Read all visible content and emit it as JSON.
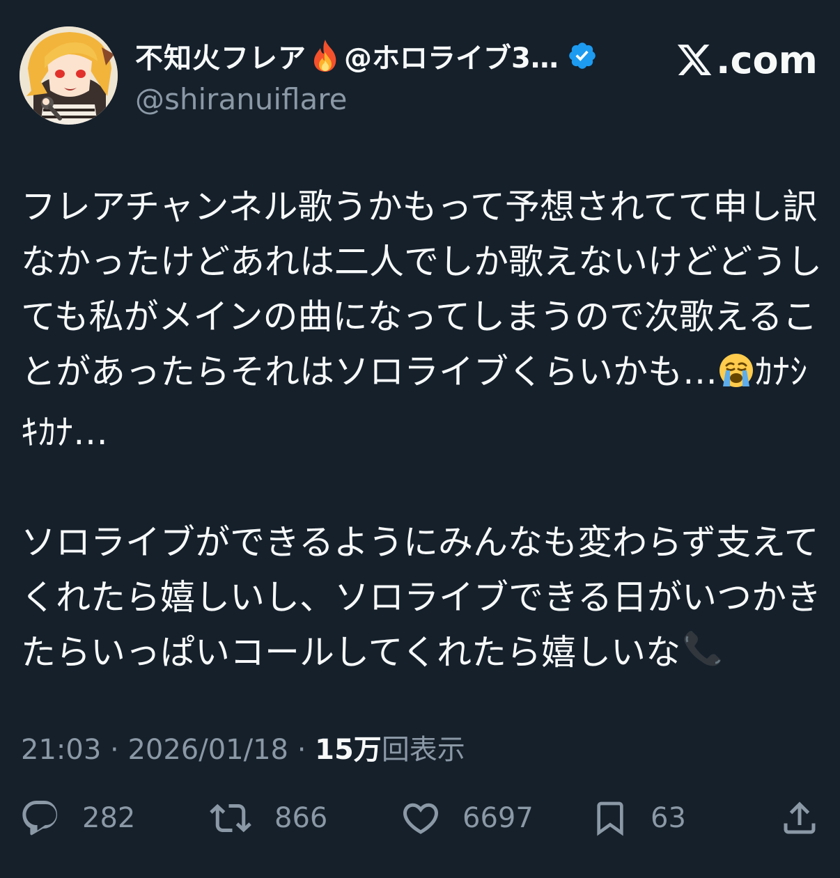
{
  "header": {
    "display_name": "不知火フレア",
    "org_name": "@ホロライブ3…",
    "handle": "@shiranuiflare",
    "brand": ".com"
  },
  "icons": {
    "avatar": "avatar-image",
    "name_emoji": "fire-icon",
    "badge": "verified-badge-icon",
    "logo": "x-logo-icon",
    "reply": "reply-icon",
    "retweet": "retweet-icon",
    "like": "heart-icon",
    "bookmark": "bookmark-icon",
    "share": "share-icon"
  },
  "colors": {
    "background": "#15202b",
    "text": "#f7f9f9",
    "muted": "#8b98a5",
    "verified": "#1d9bf0"
  },
  "tweet": {
    "paragraph1_main": "フレアチャンネル歌うかもって予想されてて申し訳なかったけどあれは二人でしか歌えないけどどうしても私がメインの曲になってしまうので次歌えることがあったらそれはソロライブくらいかも…",
    "paragraph1_emoji": "crying-face-emoji",
    "paragraph1_tail": "ｶﾅｼｷｶﾅ…",
    "paragraph2_main": "ソロライブができるようにみんなも変わらず支えてくれたら嬉しいし、ソロライブできる日がいつかきたらいっぱいコールしてくれたら嬉しいな",
    "paragraph2_emoji": "telephone-receiver-emoji"
  },
  "meta": {
    "time": "21:03",
    "sep1": " · ",
    "date": "2026/01/18",
    "sep2": " · ",
    "views_count": "15万",
    "views_label": "回表示"
  },
  "actions": {
    "reply_count": "282",
    "retweet_count": "866",
    "like_count": "6697",
    "bookmark_count": "63"
  }
}
